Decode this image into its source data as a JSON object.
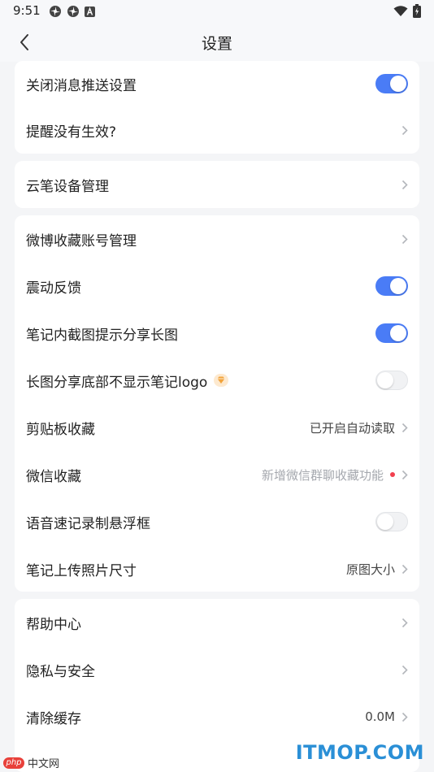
{
  "status_bar": {
    "time": "9:51",
    "left_icons": [
      "pinwheel-icon",
      "pinwheel-icon",
      "a-badge-icon"
    ],
    "right_icons": [
      "wifi-icon",
      "battery-icon"
    ]
  },
  "header": {
    "title": "设置",
    "back_icon": "chevron-left-icon"
  },
  "accent_color": "#4a7cf6",
  "sections": [
    {
      "rows": [
        {
          "label": "关闭消息推送设置",
          "toggle": true
        },
        {
          "label": "提醒没有生效?",
          "chevron": true
        }
      ]
    },
    {
      "rows": [
        {
          "label": "云笔设备管理",
          "chevron": true
        }
      ]
    },
    {
      "rows": [
        {
          "label": "微博收藏账号管理",
          "chevron": true
        },
        {
          "label": "震动反馈",
          "toggle": true
        },
        {
          "label": "笔记内截图提示分享长图",
          "toggle": true
        },
        {
          "label": "长图分享底部不显示笔记logo",
          "toggle": false,
          "badge_icon": "vip-diamond-icon"
        },
        {
          "label": "剪贴板收藏",
          "value": "已开启自动读取",
          "chevron": true
        },
        {
          "label": "微信收藏",
          "value": "新增微信群聊收藏功能",
          "red_dot": true,
          "chevron": true
        },
        {
          "label": "语音速记录制悬浮框",
          "toggle": false
        },
        {
          "label": "笔记上传照片尺寸",
          "value": "原图大小",
          "chevron": true
        }
      ]
    },
    {
      "rows": [
        {
          "label": "帮助中心",
          "chevron": true
        },
        {
          "label": "隐私与安全",
          "chevron": true
        },
        {
          "label": "清除缓存",
          "value": "0.0M",
          "chevron": true
        }
      ]
    }
  ],
  "watermark": {
    "left_logo": "php",
    "left_text": "中文网",
    "right_text": "ITMOP.COM"
  }
}
